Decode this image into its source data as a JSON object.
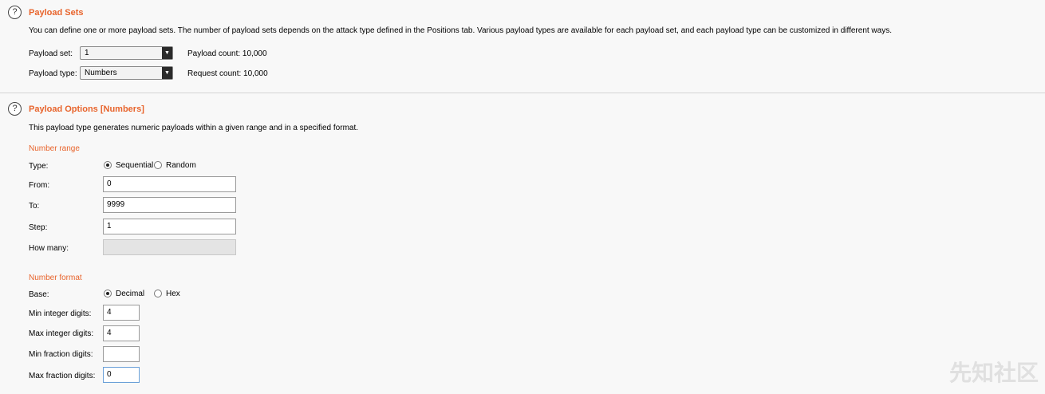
{
  "payload_sets": {
    "title": "Payload Sets",
    "description": "You can define one or more payload sets. The number of payload sets depends on the attack type defined in the Positions tab. Various payload types are available for each payload set, and each payload type can be customized in different ways.",
    "set_label": "Payload set:",
    "set_value": "1",
    "type_label": "Payload type:",
    "type_value": "Numbers",
    "payload_count": "Payload count:  10,000",
    "request_count": "Request count:  10,000"
  },
  "payload_options": {
    "title": "Payload Options [Numbers]",
    "description": "This payload type generates numeric payloads within a given range and in a specified format.",
    "number_range": {
      "heading": "Number range",
      "type_label": "Type:",
      "sequential_label": "Sequential",
      "random_label": "Random",
      "selected": "Sequential",
      "from_label": "From:",
      "from_value": "0",
      "to_label": "To:",
      "to_value": "9999",
      "step_label": "Step:",
      "step_value": "1",
      "how_many_label": "How many:",
      "how_many_value": ""
    },
    "number_format": {
      "heading": "Number format",
      "base_label": "Base:",
      "decimal_label": "Decimal",
      "hex_label": "Hex",
      "selected": "Decimal",
      "min_int_label": "Min integer digits:",
      "min_int_value": "4",
      "max_int_label": "Max integer digits:",
      "max_int_value": "4",
      "min_frac_label": "Min fraction digits:",
      "min_frac_value": "",
      "max_frac_label": "Max fraction digits:",
      "max_frac_value": "0"
    }
  },
  "watermark": "先知社区",
  "colors": {
    "accent": "#e8642c",
    "background": "#f8f8f8"
  }
}
